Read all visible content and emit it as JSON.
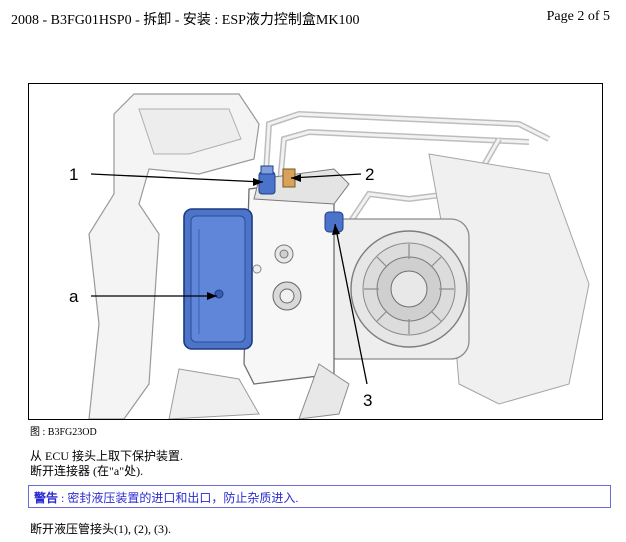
{
  "header": {
    "title": "2008 - B3FG01HSP0 - 拆卸 - 安装 : ESP液力控制盒MK100",
    "page": "Page 2 of 5"
  },
  "figure": {
    "callouts": [
      "1",
      "2",
      "a",
      "3"
    ],
    "caption": "图 : B3FG23OD"
  },
  "steps": {
    "line1": "从 ECU 接头上取下保护装置.",
    "line2": "断开连接器 (在\"a\"处).",
    "line3": "断开液压管接头(1), (2), (3)."
  },
  "warning": {
    "label": "警告",
    "text": " : 密封液压装置的进口和出口，防止杂质进入."
  }
}
